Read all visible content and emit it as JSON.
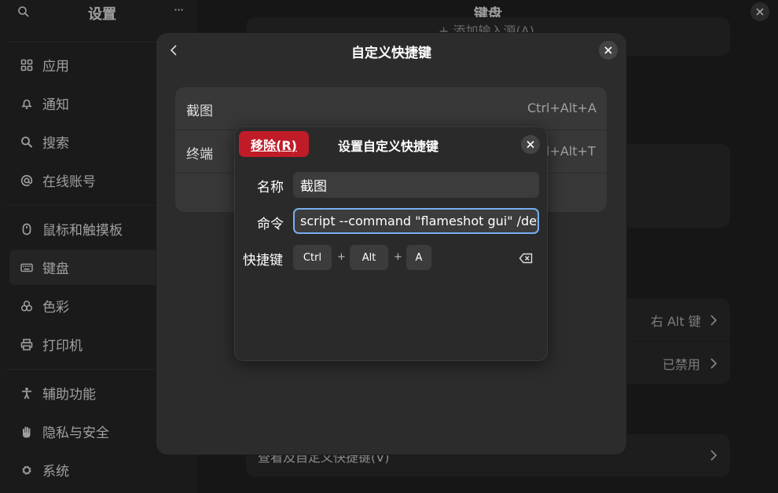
{
  "sidebar": {
    "title": "设置",
    "items": [
      {
        "label": "应用",
        "icon": "apps-grid-icon"
      },
      {
        "label": "通知",
        "icon": "bell-icon"
      },
      {
        "label": "搜索",
        "icon": "search-icon"
      },
      {
        "label": "在线账号",
        "icon": "at-icon"
      },
      {
        "label": "鼠标和触摸板",
        "icon": "mouse-icon"
      },
      {
        "label": "键盘",
        "icon": "keyboard-icon"
      },
      {
        "label": "色彩",
        "icon": "color-icon"
      },
      {
        "label": "打印机",
        "icon": "printer-icon"
      },
      {
        "label": "辅助功能",
        "icon": "accessibility-icon"
      },
      {
        "label": "隐私与安全",
        "icon": "hand-icon"
      },
      {
        "label": "系统",
        "icon": "gear-icon"
      }
    ],
    "active_index": 5
  },
  "main": {
    "title": "键盘",
    "top_partial_text": "+ 添加输入源(A)",
    "rows": [
      {
        "value": "右 Alt 键"
      },
      {
        "value": "已禁用"
      }
    ],
    "bottom_row_label": "查看及自定义快捷键(V)"
  },
  "custom_shortcuts_dialog": {
    "title": "自定义快捷键",
    "shortcuts": [
      {
        "name": "截图",
        "keys": "Ctrl+Alt+A"
      },
      {
        "name": "终端",
        "keys": "Ctrl+Alt+T"
      }
    ]
  },
  "set_shortcut_dialog": {
    "remove_label": "移除(R)",
    "title": "设置自定义快捷键",
    "name_label": "名称",
    "name_value": "截图",
    "command_label": "命令",
    "command_value": "script --command \"flameshot gui\" /dev",
    "shortcut_label": "快捷键",
    "keys": [
      "Ctrl",
      "Alt",
      "A"
    ],
    "plus": "+"
  },
  "colors": {
    "destructive": "#c01c28",
    "focus": "#78aeed"
  }
}
